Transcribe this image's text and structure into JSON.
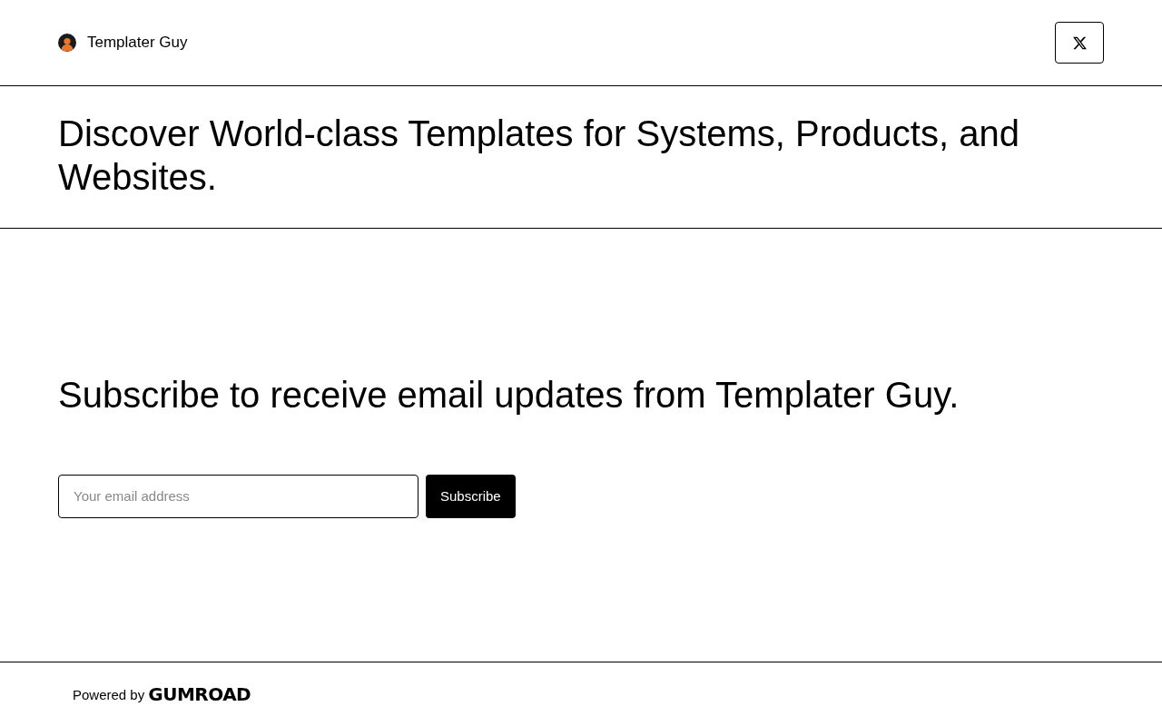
{
  "header": {
    "creator_name": "Templater Guy"
  },
  "hero": {
    "title": "Discover World-class Templates for Systems, Products, and Websites."
  },
  "subscribe": {
    "title": "Subscribe to receive email updates from Templater Guy.",
    "email_field": {
      "placeholder": "Your email address"
    },
    "button": "Subscribe"
  },
  "footer": {
    "powered_by": "Powered by",
    "logo": "GUMROAD"
  }
}
